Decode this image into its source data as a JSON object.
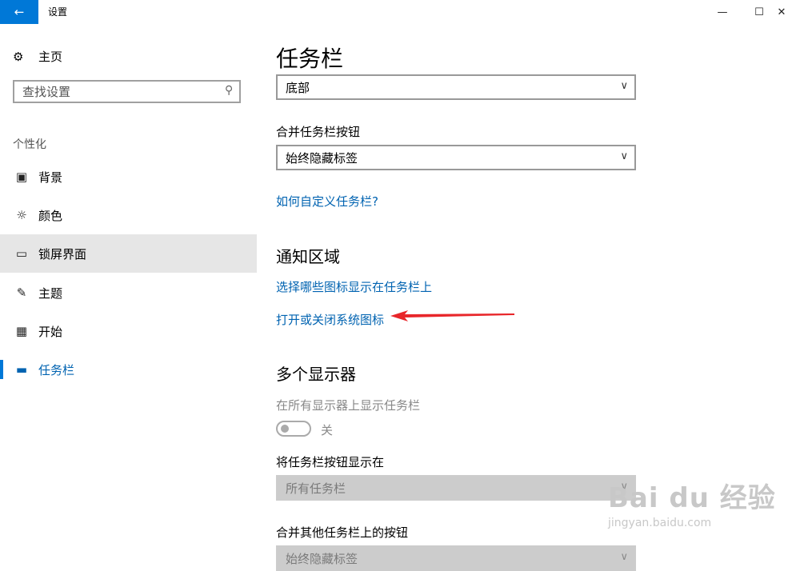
{
  "window": {
    "app_title": "设置",
    "back_icon": "back-arrow-icon",
    "accent_color": "#0078d7"
  },
  "sidebar": {
    "home_label": "主页",
    "search_placeholder": "查找设置",
    "section_label": "个性化",
    "items": [
      {
        "label": "背景",
        "icon": "picture-icon"
      },
      {
        "label": "颜色",
        "icon": "palette-icon"
      },
      {
        "label": "锁屏界面",
        "icon": "lock-screen-icon"
      },
      {
        "label": "主题",
        "icon": "theme-brush-icon"
      },
      {
        "label": "开始",
        "icon": "start-grid-icon"
      },
      {
        "label": "任务栏",
        "icon": "taskbar-icon"
      }
    ]
  },
  "main": {
    "title": "任务栏",
    "taskbar_location_value": "底部",
    "combine_label": "合并任务栏按钮",
    "combine_value": "始终隐藏标签",
    "customize_link": "如何自定义任务栏?",
    "notification_heading": "通知区域",
    "select_icons_link": "选择哪些图标显示在任务栏上",
    "system_icons_link": "打开或关闭系统图标",
    "multi_display_heading": "多个显示器",
    "show_on_all_label": "在所有显示器上显示任务栏",
    "toggle_state": "关",
    "show_buttons_label": "将任务栏按钮显示在",
    "show_buttons_value": "所有任务栏",
    "combine_other_label": "合并其他任务栏上的按钮",
    "combine_other_value": "始终隐藏标签"
  },
  "watermark": {
    "brand": "Bai du 经验",
    "url": "jingyan.baidu.com"
  }
}
